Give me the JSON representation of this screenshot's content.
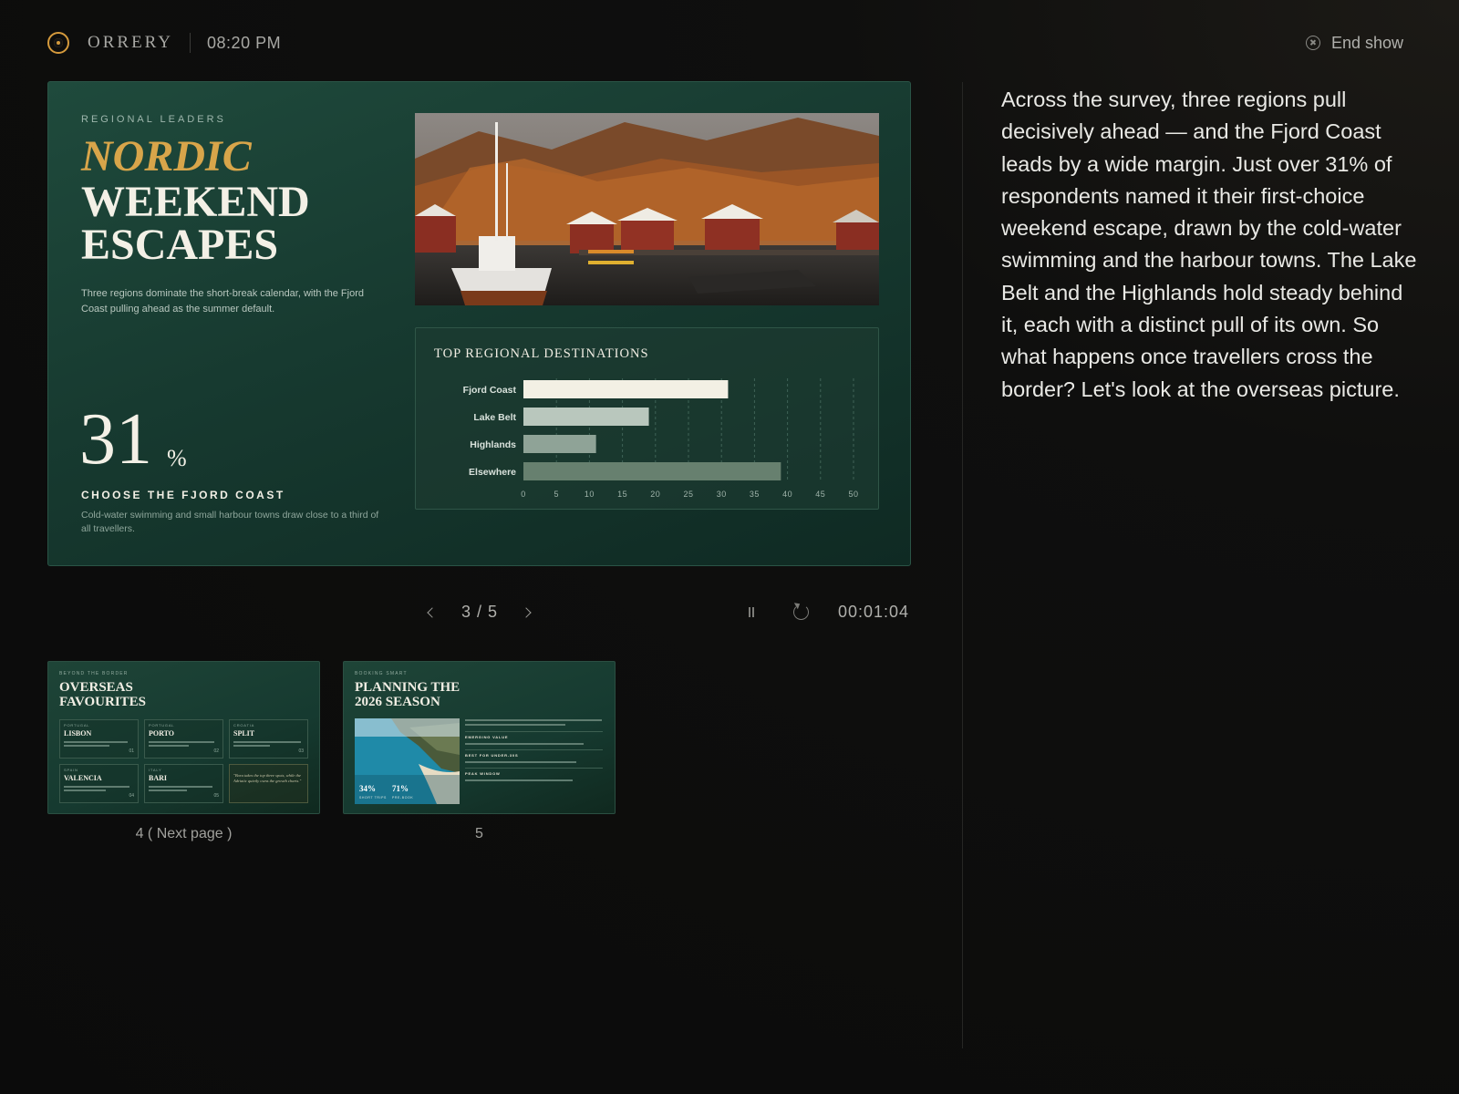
{
  "app": {
    "brand": "ORRERY",
    "clock": "08:20 PM",
    "end_show_label": "End show"
  },
  "slide": {
    "eyebrow": "REGIONAL LEADERS",
    "title_accent": "NORDIC",
    "title_line2": "WEEKEND",
    "title_line3": "ESCAPES",
    "subtitle": "Three regions dominate the short-break calendar, with the Fjord Coast pulling ahead as the summer default.",
    "stat_value": "31",
    "stat_unit": "%",
    "stat_label": "CHOOSE THE FJORD COAST",
    "stat_description": "Cold-water swimming and small harbour towns draw close to a third of all travellers."
  },
  "chart_data": {
    "type": "bar",
    "orientation": "horizontal",
    "title": "TOP REGIONAL DESTINATIONS",
    "categories": [
      "Fjord Coast",
      "Lake Belt",
      "Highlands",
      "Elsewhere"
    ],
    "values": [
      31,
      19,
      11,
      39
    ],
    "bar_colors": [
      "#f3f0e4",
      "#b9c7bd",
      "#8fa397",
      "#67806f"
    ],
    "x_ticks": [
      0,
      5,
      10,
      15,
      20,
      25,
      30,
      35,
      40,
      45,
      50
    ],
    "xlim": [
      0,
      50
    ],
    "grid": true
  },
  "controls": {
    "page_indicator": "3 / 5",
    "timer": "00:01:04"
  },
  "thumbnails": [
    {
      "eyebrow": "BEYOND THE BORDER",
      "title_line1": "OVERSEAS",
      "title_line2": "FAVOURITES",
      "caption": "4 ( Next page )",
      "cards": [
        {
          "region": "PORTUGAL",
          "city": "LISBON",
          "num": "01"
        },
        {
          "region": "PORTUGAL",
          "city": "PORTO",
          "num": "02"
        },
        {
          "region": "CROATIA",
          "city": "SPLIT",
          "num": "03"
        },
        {
          "region": "SPAIN",
          "city": "VALENCIA",
          "num": "04"
        },
        {
          "region": "ITALY",
          "city": "BARI",
          "num": "05"
        }
      ],
      "quote": "\"Bora takes the top three spots, while the Adriatic quietly owns the growth charts.\""
    },
    {
      "eyebrow": "BOOKING SMART",
      "title_line1": "PLANNING THE",
      "title_line2": "2026 SEASON",
      "caption": "5",
      "stat1": "34%",
      "stat1_label": "SHORT TRIPS",
      "stat2": "71%",
      "stat2_label": "PRE-BOOK",
      "headings": [
        "EMERGING VALUE",
        "BEST FOR UNDER-30S",
        "PEAK WINDOW"
      ]
    }
  ],
  "speaker_notes": "Across the survey, three regions pull decisively ahead — and the Fjord Coast leads by a wide margin. Just over 31% of respondents named it their first-choice weekend escape, drawn by the cold-water swimming and the harbour towns. The Lake Belt and the Highlands hold steady behind it, each with a distinct pull of its own. So what happens once travellers cross the border? Let's look at the overseas picture."
}
